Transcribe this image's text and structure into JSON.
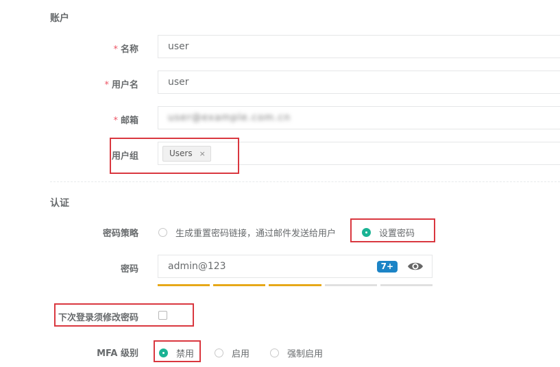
{
  "account": {
    "section_title": "账户",
    "name_label": "名称",
    "name_value": "user",
    "username_label": "用户名",
    "username_value": "user",
    "email_label": "邮箱",
    "email_value": "user@example.com.cn",
    "group_label": "用户组",
    "group_tags": [
      "Users"
    ],
    "required_mark": "*"
  },
  "auth": {
    "section_title": "认证",
    "policy_label": "密码策略",
    "policy_options": [
      "生成重置密码链接，通过邮件发送给用户",
      "设置密码"
    ],
    "policy_selected": 1,
    "password_label": "密码",
    "password_value": "admin@123",
    "password_badge": "7+",
    "strength_filled": 3,
    "strength_total": 5,
    "strength_color": "#e6a818",
    "force_change_label": "下次登录须修改密码",
    "force_change_checked": false,
    "mfa_label": "MFA 级别",
    "mfa_options": [
      "禁用",
      "启用",
      "强制启用"
    ],
    "mfa_selected": 0
  },
  "colors": {
    "accent": "#1ab394",
    "badge": "#1c84c6",
    "required": "#ed5565",
    "highlight": "#d9363e"
  },
  "icons": {
    "eye": "eye-icon",
    "tag_remove": "close-icon"
  }
}
